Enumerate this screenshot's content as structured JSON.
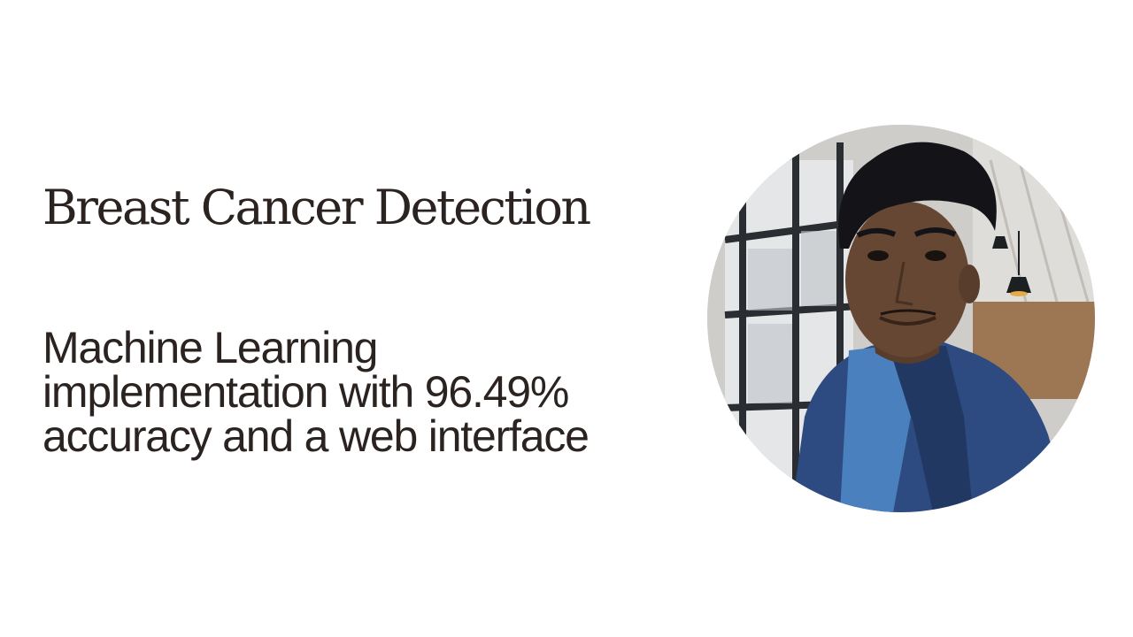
{
  "theme": {
    "background": "#ffffff",
    "text": "#2a2320"
  },
  "slide": {
    "title": "Breast Cancer Detection",
    "subtitle_lines": [
      "Machine Learning",
      "implementation with 96.49%",
      "accuracy and a web interface"
    ]
  },
  "avatar": {
    "icon": "profile-photo",
    "colors": {
      "backdrop": "#d8d6d2",
      "window_frame": "#2c2f33",
      "glass": "#eef0f2",
      "wood_wall": "#a47b58",
      "ceiling": "#e8e6e3",
      "lamp": "#1f2224",
      "skin": "#6b4a36",
      "hair": "#15151a",
      "jacket": "#2f4f86",
      "shirt": "#4f86c6"
    }
  }
}
